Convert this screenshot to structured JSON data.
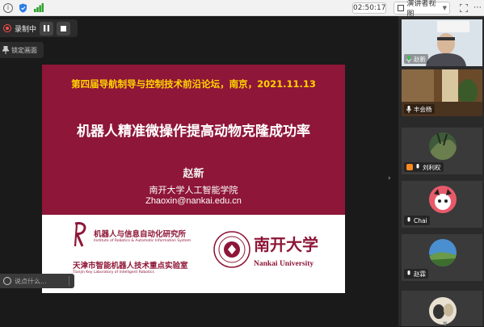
{
  "topbar": {
    "timer": "02:50:17",
    "view_button": "演讲者视图",
    "icons": [
      "info-icon",
      "shield-icon",
      "signal-icon",
      "fullscreen-icon",
      "more-icon"
    ]
  },
  "recording": {
    "status": "录制中",
    "pin_label": "锁定画面"
  },
  "slide": {
    "subtitle": "第四届导航制导与控制技术前沿论坛，南京，2021.11.13",
    "title": "机器人精准微操作提高动物克隆成功率",
    "author": "赵新",
    "affiliation": "南开大学人工智能学院",
    "email": "Zhaoxin@nankai.edu.cn",
    "lab_name": "机器人与信息自动化研究所",
    "lab_name_en": "Institute of Robotics & Automatic Information System",
    "lab_sub": "天津市智能机器人技术重点实验室",
    "lab_sub_en": "Tianjin Key Laboratory of Intelligent Robotics",
    "university_cn": "南开大学",
    "university_en": "Nankai University",
    "colors": {
      "maroon": "#8e1638",
      "yellow": "#ffd400"
    }
  },
  "chat": {
    "placeholder": "说点什么..."
  },
  "participants": [
    {
      "name": "赵新"
    },
    {
      "name": "丰会杨"
    },
    {
      "name": "刘利权"
    },
    {
      "name": "Chai"
    },
    {
      "name": "赵霖"
    },
    {
      "name": ""
    }
  ]
}
